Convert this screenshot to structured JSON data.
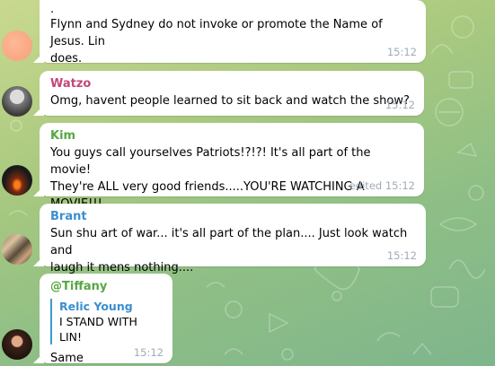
{
  "colors": {
    "watzo": "#c3467b",
    "kim": "#55a842",
    "brant": "#3a8fd0",
    "tiffany": "#55a842"
  },
  "messages": [
    {
      "sender": "",
      "lines": [
        ".",
        "Flynn and Sydney do not invoke or promote the Name of Jesus. Lin",
        "does."
      ],
      "time": "15:12",
      "avatar": "peach-avatar"
    },
    {
      "sender": "Watzo",
      "lines": [
        "Omg, havent people learned to sit back and watch the show?"
      ],
      "time": "15:12",
      "avatar": "bw-portrait-avatar"
    },
    {
      "sender": "Kim",
      "lines": [
        "You guys call yourselves Patriots!?!?! It's all part of the movie!",
        "They're ALL very good friends.....YOU'RE WATCHING A MOVIE!!!"
      ],
      "time": "edited 15:12",
      "avatar": "sunset-avatar"
    },
    {
      "sender": "Brant",
      "lines": [
        "Sun shu art of war... it's all part of the plan.... Just look watch and",
        "laugh it mens nothing...."
      ],
      "time": "15:12",
      "avatar": "group-avatar"
    },
    {
      "sender": "@Tiffany",
      "reply": {
        "name": "Relic Young",
        "text": "I STAND WITH LIN!"
      },
      "lines": [
        "Same"
      ],
      "time": "15:12",
      "avatar": "woman-avatar"
    }
  ]
}
